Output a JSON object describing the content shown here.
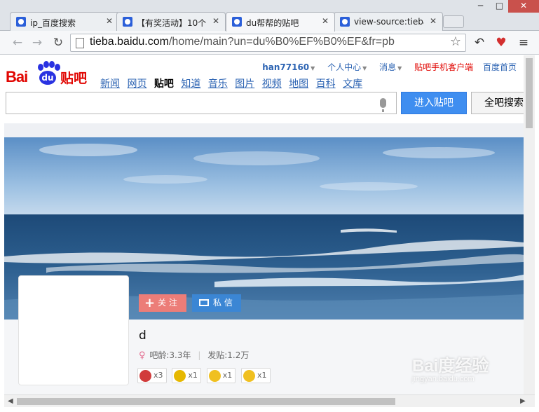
{
  "browser": {
    "tabs": [
      {
        "title": "ip_百度搜索",
        "active": false
      },
      {
        "title": "【有奖活动】10个",
        "active": false
      },
      {
        "title": "du帮帮的贴吧",
        "active": true
      },
      {
        "title": "view-source:tieba",
        "active": false
      }
    ],
    "url_host": "tieba.baidu.com",
    "url_path": "/home/main?un=du%B0%EF%B0%EF&fr=pb",
    "window_controls": {
      "minimize": "─",
      "maximize": "□",
      "close": "✕"
    }
  },
  "header": {
    "logo": {
      "bai": "Bai",
      "du": "du",
      "tieba": "贴吧"
    },
    "username": "han77160",
    "personal_center": "个人中心",
    "messages": "消息",
    "mobile_client": "贴吧手机客户端",
    "baidu_home": "百度首页",
    "channels": [
      "新闻",
      "网页",
      "贴吧",
      "知道",
      "音乐",
      "图片",
      "视频",
      "地图",
      "百科",
      "文库"
    ],
    "current_channel": "贴吧"
  },
  "search": {
    "value": "",
    "enter_button": "进入贴吧",
    "search_all_button": "全吧搜索"
  },
  "profile": {
    "follow_button": "关 注",
    "message_button": "私 信",
    "name": "d",
    "gender_symbol": "♀",
    "age_text": "吧龄:3.3年",
    "posts_text": "发贴:1.2万",
    "badges": [
      {
        "icon": "avatar-badge-icon",
        "count": "x3",
        "color": "#d13b3b"
      },
      {
        "icon": "level-badge-icon",
        "count": "x1",
        "color": "#e6b800"
      },
      {
        "icon": "star-badge-icon",
        "count": "x1",
        "color": "#f0c020"
      },
      {
        "icon": "star-lock-badge-icon",
        "count": "x1",
        "color": "#f0c020"
      }
    ]
  },
  "watermark": {
    "text": "Bai度经验",
    "sub": "jingyan.baidu.com"
  },
  "colors": {
    "accent": "#3f8ef0",
    "brand_red": "#e10602",
    "link": "#2d64b3"
  }
}
